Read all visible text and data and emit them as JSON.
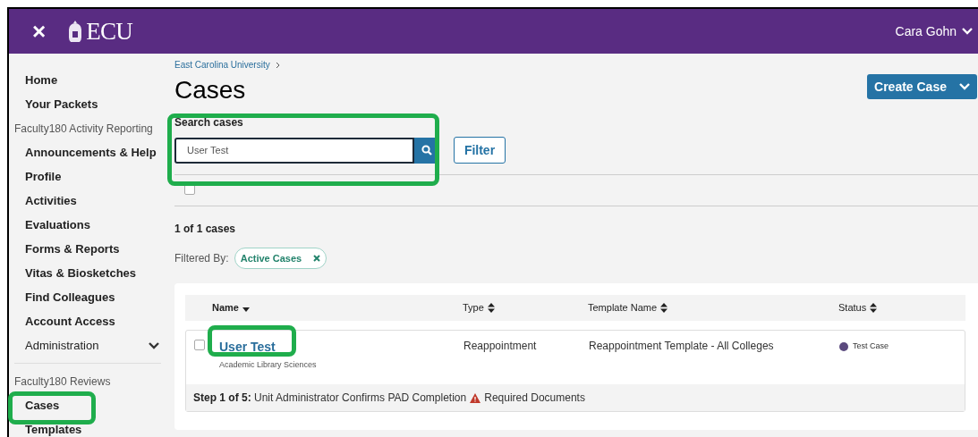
{
  "header": {
    "close_label": "×",
    "logo_text": "ECU",
    "user_name": "Cara Gohn"
  },
  "sidebar": {
    "sections": [
      {
        "items": [
          {
            "label": "Home",
            "expandable": false
          },
          {
            "label": "Your Packets",
            "expandable": false
          }
        ]
      },
      {
        "heading": "Faculty180 Activity Reporting",
        "items": [
          {
            "label": "Announcements & Help",
            "expandable": false
          },
          {
            "label": "Profile",
            "expandable": false
          },
          {
            "label": "Activities",
            "expandable": false
          },
          {
            "label": "Evaluations",
            "expandable": false
          },
          {
            "label": "Forms & Reports",
            "expandable": false
          },
          {
            "label": "Vitas & Biosketches",
            "expandable": false
          },
          {
            "label": "Find Colleagues",
            "expandable": false
          },
          {
            "label": "Account Access",
            "expandable": false
          },
          {
            "label": "Administration",
            "expandable": true
          }
        ]
      },
      {
        "heading": "Faculty180 Reviews",
        "items": [
          {
            "label": "Cases",
            "expandable": false
          },
          {
            "label": "Templates",
            "expandable": false
          }
        ]
      }
    ]
  },
  "breadcrumb": [
    "East Carolina University"
  ],
  "page_title": "Cases",
  "create_button": "Create Case",
  "search": {
    "label": "Search cases",
    "value": "User Test"
  },
  "filter_button": "Filter",
  "select_all": {
    "checked": false
  },
  "result_count": "1 of 1 cases",
  "filtered_by": {
    "label": "Filtered By:",
    "chips": [
      "Active Cases"
    ]
  },
  "table": {
    "columns": [
      {
        "label": "Name",
        "sorted": true
      },
      {
        "label": "Type",
        "sorted": false
      },
      {
        "label": "Template Name",
        "sorted": false
      },
      {
        "label": "Status",
        "sorted": false
      }
    ],
    "rows": [
      {
        "checked": false,
        "name": "User Test",
        "unit": "Academic Library Sciences",
        "type": "Reappointment",
        "template": "Reappointment Template - All Colleges",
        "status": "Test Case",
        "color": "#5b4a7e",
        "step_label": "Step 1 of 5:",
        "step_text": "Unit Administrator Confirms PAD Completion",
        "warning": "Required Documents"
      }
    ]
  }
}
